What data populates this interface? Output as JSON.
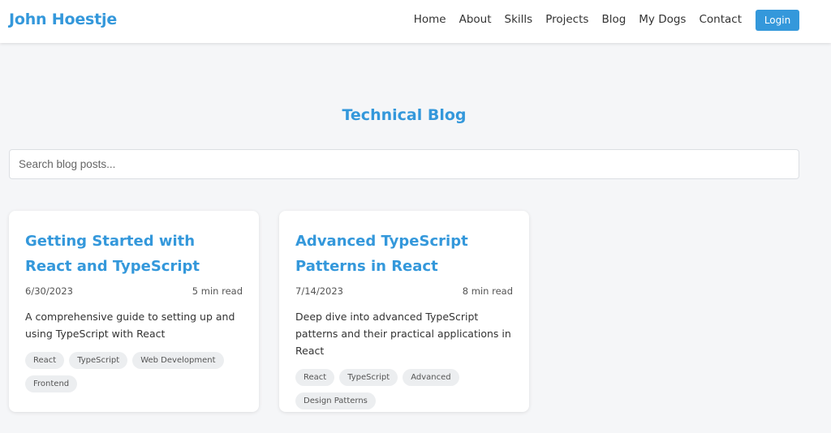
{
  "nav": {
    "brand": "John Hoestje",
    "links": [
      "Home",
      "About",
      "Skills",
      "Projects",
      "Blog",
      "My Dogs",
      "Contact"
    ],
    "login_label": "Login"
  },
  "page": {
    "title": "Technical Blog",
    "search_placeholder": "Search blog posts..."
  },
  "posts": [
    {
      "title": "Getting Started with React and TypeScript",
      "date": "6/30/2023",
      "read_time": "5 min read",
      "excerpt": "A comprehensive guide to setting up and using TypeScript with React",
      "tags": [
        "React",
        "TypeScript",
        "Web Development",
        "Frontend"
      ]
    },
    {
      "title": "Advanced TypeScript Patterns in React",
      "date": "7/14/2023",
      "read_time": "8 min read",
      "excerpt": "Deep dive into advanced TypeScript patterns and their practical applications in React",
      "tags": [
        "React",
        "TypeScript",
        "Advanced",
        "Design Patterns"
      ]
    }
  ],
  "colors": {
    "accent": "#3498db",
    "background": "#f5f6f8",
    "tag_bg": "#eceef0"
  }
}
